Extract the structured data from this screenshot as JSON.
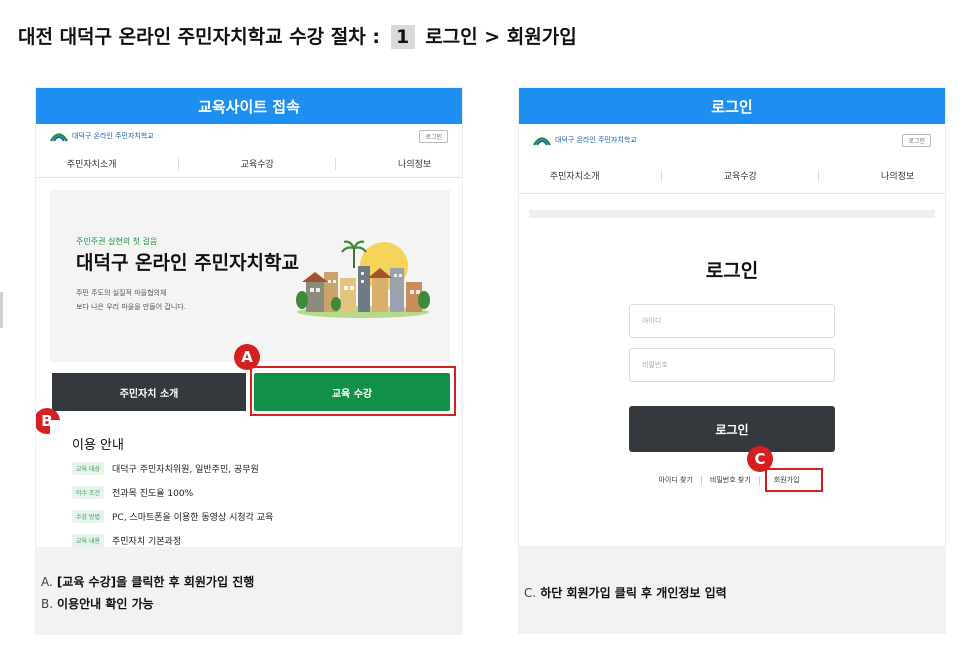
{
  "title": {
    "prefix": "대전 대덕구 온라인 주민자치학교 수강 절차 :",
    "step": "1",
    "suffix": "로그인 > 회원가입"
  },
  "left_panel": {
    "header": "교육사이트 접속",
    "site_logo_text": "대덕구 온라인 주민자치학교",
    "login_small": "로그인",
    "nav": [
      "주민자치소개",
      "교육수강",
      "나의정보"
    ],
    "hero": {
      "subtitle": "주민주권 실현의 첫 걸음",
      "title": "대덕구 온라인 주민자치학교",
      "desc_line1": "주민 주도의 실질적 마을협의체",
      "desc_line2": "보다 나은 우리 마을을 만들어 갑니다."
    },
    "btn_intro": "주민자치 소개",
    "btn_course": "교육 수강",
    "marker_a": "A",
    "marker_b": "B",
    "info": {
      "title": "이용 안내",
      "rows": [
        {
          "tag": "교육 대상",
          "text": "대덕구 주민자치위원, 일반주민, 공무원"
        },
        {
          "tag": "이수 조건",
          "text": "전과목 진도율 100%"
        },
        {
          "tag": "수강 방법",
          "text": "PC, 스마트폰을 이용한 동영상 시청각 교육"
        },
        {
          "tag": "교육 내용",
          "text": "주민자치 기본과정"
        }
      ]
    }
  },
  "right_panel": {
    "header": "로그인",
    "site_logo_text": "대덕구 온라인 주민자치학교",
    "login_small": "로그인",
    "nav": [
      "주민자치소개",
      "교육수강",
      "나의정보"
    ],
    "login_title": "로그인",
    "id_placeholder": "아이디",
    "pw_placeholder": "비밀번호",
    "btn_login": "로그인",
    "links": [
      "아이디 찾기",
      "비밀번호 찾기",
      "회원가입"
    ],
    "marker_c": "C"
  },
  "captions": {
    "a_letter": "A.",
    "a_text": "[교육 수강]을 클릭한 후 회원가입 진행",
    "b_letter": "B.",
    "b_text": "이용안내 확인 가능",
    "c_letter": "C.",
    "c_text": "하단 회원가입 클릭 후 개인정보 입력"
  },
  "colors": {
    "header_blue": "#1f8ef1",
    "course_green": "#12904a",
    "dark_button": "#35383d",
    "highlight_red": "#d62020"
  }
}
